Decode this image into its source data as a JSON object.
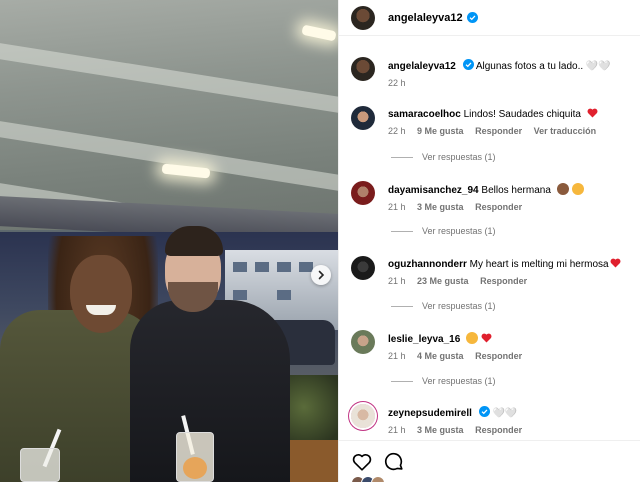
{
  "post": {
    "author": "angelaleyva12",
    "caption_text": "Algunas fotos a tu lado.. 🤍🤍",
    "caption_time": "22 h"
  },
  "colors": {
    "verified": "#0095f6",
    "heart": "#ff3040",
    "meta_gray": "#737373"
  },
  "comments": [
    {
      "username": "samaracoelhoc",
      "text": "Lindos! Saudades chiquita",
      "emoji": "heart",
      "time": "22 h",
      "likes": "9 Me gusta",
      "reply": "Responder",
      "translate": "Ver traducción",
      "replies": "Ver respuestas (1)",
      "verified": false
    },
    {
      "username": "dayamisanchez_94",
      "text": "Bellos hermana",
      "emoji": "faces",
      "time": "21 h",
      "likes": "3 Me gusta",
      "reply": "Responder",
      "replies": "Ver respuestas (1)",
      "verified": false
    },
    {
      "username": "oguzhannonderr",
      "text": "My heart is melting mi hermosa",
      "emoji": "heart",
      "time": "21 h",
      "likes": "23 Me gusta",
      "reply": "Responder",
      "replies": "Ver respuestas (1)",
      "verified": false
    },
    {
      "username": "leslie_leyva_16",
      "text": "",
      "emoji": "heart-eyes-heart",
      "time": "21 h",
      "likes": "4 Me gusta",
      "reply": "Responder",
      "replies": "Ver respuestas (1)",
      "verified": false
    },
    {
      "username": "zeynepsudemirell",
      "text": "🤍🤍",
      "emoji": "",
      "time": "21 h",
      "likes": "3 Me gusta",
      "reply": "Responder",
      "verified": true
    }
  ],
  "icons": {
    "like": "heart-outline-icon",
    "comment": "comment-bubble-icon",
    "next": "chevron-right-icon"
  }
}
